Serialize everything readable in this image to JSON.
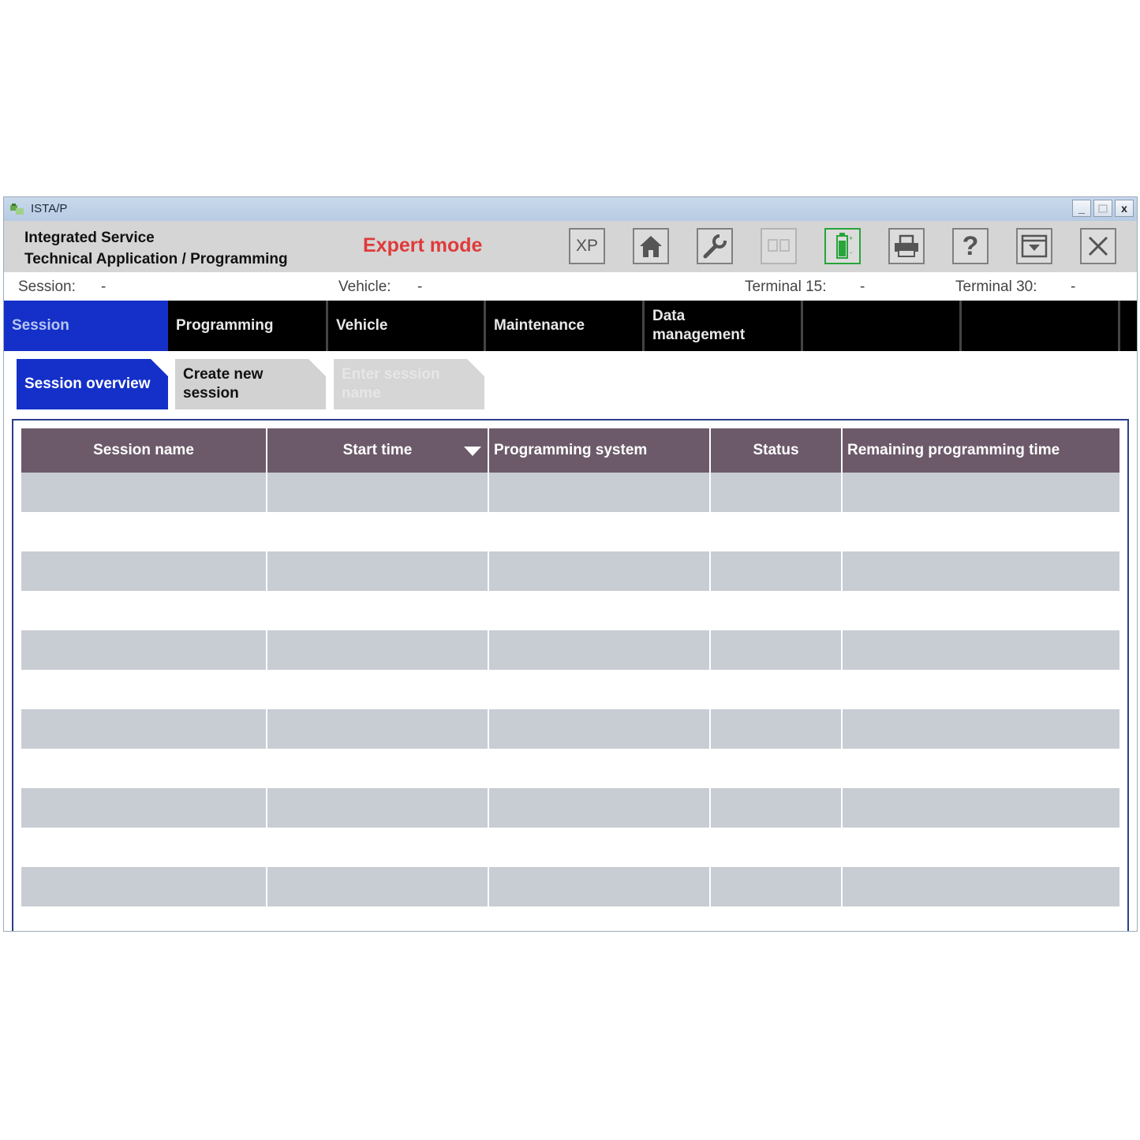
{
  "window": {
    "title": "ISTA/P",
    "minimize": "_",
    "close": "x"
  },
  "header": {
    "app_name_line1": "Integrated Service",
    "app_name_line2": "Technical Application / Programming",
    "mode": "Expert mode",
    "toolbar": {
      "xp_label": "XP",
      "help_label": "?",
      "icons": [
        "xp-icon",
        "home-icon",
        "wrench-icon",
        "device-icon",
        "battery-icon",
        "printer-icon",
        "help-icon",
        "minimize-panel-icon",
        "close-icon"
      ],
      "battery_color": "#27a43a"
    }
  },
  "status": {
    "session_label": "Session:",
    "session_value": "-",
    "vehicle_label": "Vehicle:",
    "vehicle_value": "-",
    "terminal15_label": "Terminal 15:",
    "terminal15_value": "-",
    "terminal30_label": "Terminal 30:",
    "terminal30_value": "-"
  },
  "nav": {
    "items": [
      {
        "label": "Session",
        "active": true
      },
      {
        "label": "Programming"
      },
      {
        "label": "Vehicle"
      },
      {
        "label": "Maintenance"
      },
      {
        "label": "Data management"
      },
      {
        "label": ""
      },
      {
        "label": ""
      }
    ]
  },
  "subtabs": {
    "items": [
      {
        "label": "Session overview",
        "state": "active"
      },
      {
        "label": "Create new session",
        "state": "normal"
      },
      {
        "label": "Enter session name",
        "state": "disabled"
      }
    ]
  },
  "table": {
    "columns": [
      "Session name",
      "Start time",
      "Programming system",
      "Status",
      "Remaining programming time"
    ],
    "sorted_column": "Start time",
    "rows": [],
    "accent_color": "#1430c8",
    "header_color": "#6c5a6a"
  }
}
